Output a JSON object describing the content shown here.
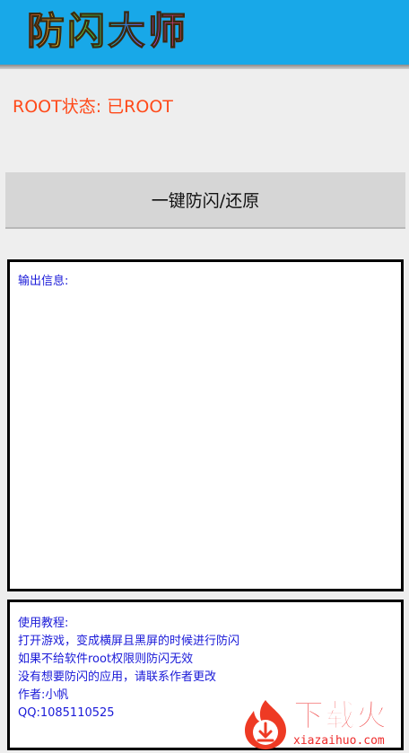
{
  "titlebar": {
    "app_title": "防闪大师",
    "background_color": "#18a8e8"
  },
  "status": {
    "root_status": "ROOT状态: 已ROOT",
    "color": "#ff4a1a"
  },
  "main_button": {
    "label": "一键防闪/还原"
  },
  "output_panel": {
    "label": "输出信息:"
  },
  "tutorial_panel": {
    "lines": [
      "使用教程:",
      "打开游戏，变成横屏且黑屏的时候进行防闪",
      "如果不给软件root权限则防闪无效",
      "没有想要防闪的应用，请联系作者更改",
      "作者:小帆",
      "QQ:1085110525"
    ],
    "text_color": "#1a1ad8"
  },
  "watermark": {
    "brand": "下载火",
    "url": "xiazaihuo.com",
    "icon": "flame-download-logo-icon",
    "color": "#ee2a2a"
  }
}
